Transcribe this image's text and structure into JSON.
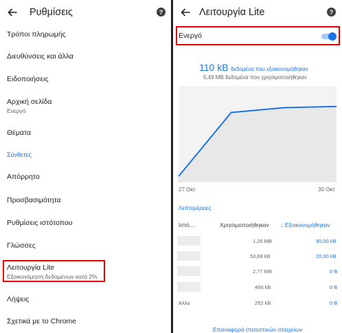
{
  "left": {
    "title": "Ρυθμίσεις",
    "items": [
      {
        "label": "Τρόποι πληρωμής"
      },
      {
        "label": "Διευθύνσεις και άλλα"
      },
      {
        "label": "Ειδοποιήσεις"
      },
      {
        "label": "Αρχική σελίδα",
        "sub": "Ενεργό"
      },
      {
        "label": "Θέματα"
      },
      {
        "label": "Απόρρητο"
      },
      {
        "label": "Προσβασιμότητα"
      },
      {
        "label": "Ρυθμίσεις ιστότοπου"
      },
      {
        "label": "Γλώσσες"
      },
      {
        "label": "Λειτουργία Lite",
        "sub": "Εξοικονόμηση δεδομένων κατά 2%"
      },
      {
        "label": "Λήψεις"
      },
      {
        "label": "Σχετικά με το Chrome"
      }
    ],
    "section_label": "Σύνθετες"
  },
  "right": {
    "title": "Λειτουργία Lite",
    "toggle_label": "Ενεργό",
    "toggle_on": true,
    "saved_value": "110 kB",
    "saved_caption": "δεδομένα που εξοικονομήθηκαν",
    "used_text": "5,49 MB δεδομένα που χρησιμοποιήθηκαν",
    "details_link": "Λεπτομέρειες",
    "table": {
      "headers": [
        "Ιστό…",
        "Χρησιμοποιήθηκαν",
        "Εξοικονομήθηκαν"
      ],
      "rows": [
        {
          "site": "",
          "used": "1,26 MB",
          "saved": "90,00 kB"
        },
        {
          "site": "",
          "used": "53,68 kB",
          "saved": "20,00 kB"
        },
        {
          "site": "",
          "used": "2,77 MB",
          "saved": "0 B"
        },
        {
          "site": "",
          "used": "466 kB",
          "saved": "0 B"
        },
        {
          "site": "Άλλο",
          "used": "252 kB",
          "saved": "0 B"
        }
      ]
    },
    "reset_button": "Επαναφορά στατιστικών στοιχείων"
  },
  "chart_data": {
    "type": "area",
    "x": [
      "27 Οκτ",
      "28 Οκτ",
      "29 Οκτ",
      "30 Οκτ"
    ],
    "x_tick_labels": [
      "27 Οκτ",
      "30 Οκτ"
    ],
    "series": [
      {
        "values": [
          5,
          58,
          62,
          63
        ]
      }
    ],
    "ylim": [
      0,
      80
    ],
    "grid": false,
    "line_color": "#1a73e8",
    "fill_color": "#e8e8e8"
  },
  "colors": {
    "accent": "#1a73e8",
    "highlight_box": "#e00000"
  }
}
